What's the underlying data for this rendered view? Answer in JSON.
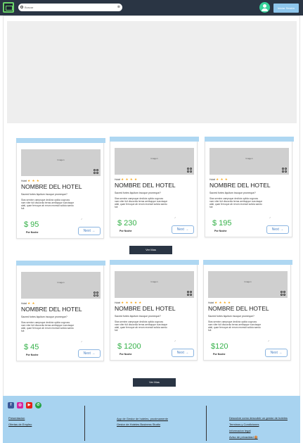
{
  "header": {
    "search_placeholder": "Buscar",
    "clear": "⊗",
    "login_label": "Iniciar Sesión"
  },
  "common": {
    "image_placeholder": "Imagen",
    "category": "Hotel",
    "hotel_name": "NOMBRE DEL HOTEL",
    "question": "Sacred fortes liquitum incoque promeque?",
    "description": "Stas semine campsque declivia opiida cognuss nam viter fuit discordia terras aeribqrque sunctaque alati, quae ferroque ab rerum recessit solicia saedu fuit",
    "mark": "✓",
    "per_night": "Por Noche",
    "next_label": "Next →",
    "ver_mas": "Ver Mas"
  },
  "hotels": [
    {
      "stars": "★ ★ ★",
      "price": "$ 95"
    },
    {
      "stars": "★ ★ ★ ★",
      "price": "$ 230"
    },
    {
      "stars": "★ ★ ★",
      "price": "$ 195"
    },
    {
      "stars": "★ ★",
      "price": "$ 45"
    },
    {
      "stars": "★ ★ ★ ★ ★",
      "price": "$ 1200"
    },
    {
      "stars": "★ ★ ★ ★",
      "price": "$120"
    }
  ],
  "footer": {
    "social": [
      {
        "icon": "facebook-icon",
        "glyph": "f",
        "color": "#3b5998"
      },
      {
        "icon": "instagram-icon",
        "glyph": "◎",
        "color": "#d6249f"
      },
      {
        "icon": "youtube-icon",
        "glyph": "▶",
        "color": "#e62117"
      },
      {
        "icon": "whatsapp-icon",
        "glyph": "✆",
        "color": "#25a244"
      }
    ],
    "col1": [
      "Presentacion",
      "Ofertas de Empleo"
    ],
    "col2": [
      "App de Gestor de hoteles, proximamente",
      "Gestor de Hoteles Business Studio"
    ],
    "col3": [
      "Descubre como descubrir un gestor de hoteles",
      "Terminos y Condiciones",
      "Informacion legal",
      "Aviso de privacidad 🍪"
    ]
  }
}
